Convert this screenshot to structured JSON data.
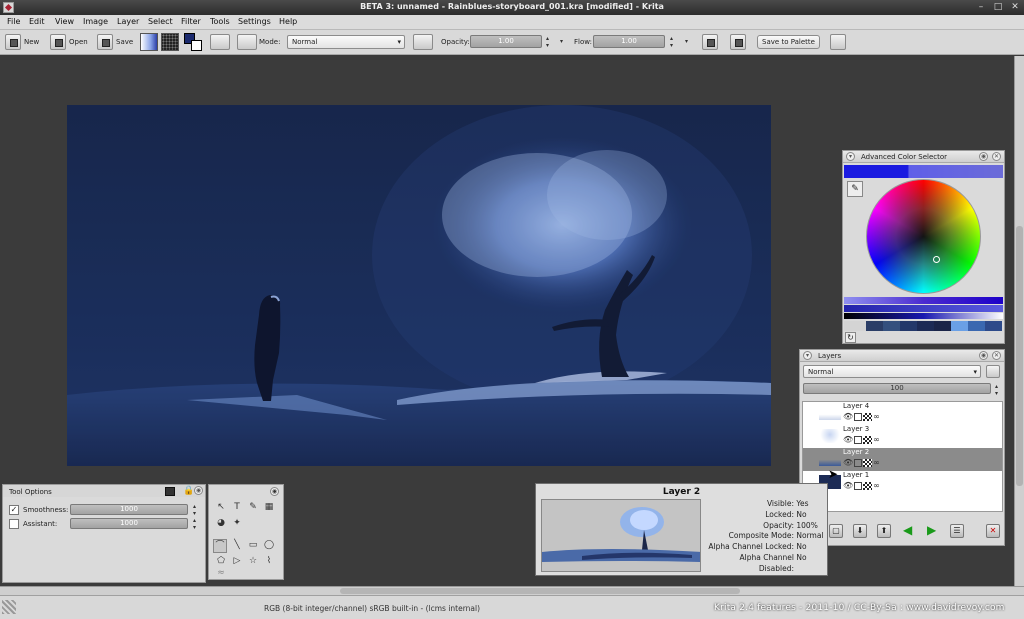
{
  "window": {
    "title": "BETA 3: unnamed - Rainblues-storyboard_001.kra [modified] - Krita",
    "controls": [
      "–",
      "□",
      "✕"
    ]
  },
  "menu": [
    "File",
    "Edit",
    "View",
    "Image",
    "Layer",
    "Select",
    "Filter",
    "Tools",
    "Settings",
    "Help"
  ],
  "toolbar": {
    "new_label": "New",
    "open_label": "Open",
    "save_label": "Save",
    "mode_label": "Mode:",
    "mode_value": "Normal",
    "opacity_label": "Opacity:",
    "opacity_value": "1.00",
    "flow_label": "Flow:",
    "flow_value": "1.00",
    "save_palette_label": "Save to Palette",
    "foreground_color": "#1b2a6e",
    "background_color": "#ffffff"
  },
  "tool_options": {
    "title": "Tool Options",
    "smoothness_label": "Smoothness:",
    "smoothness_value": "1000",
    "smoothness_checked": true,
    "assistant_label": "Assistant:",
    "assistant_value": "1000",
    "assistant_checked": false
  },
  "color_selector": {
    "title": "Advanced Color Selector",
    "current_color": "#1f1fd6",
    "history_colors": [
      "#2a3d66",
      "#34507e",
      "#23386a",
      "#1c2a55",
      "#1a2448",
      "#6aa0e6",
      "#3a68b0",
      "#2d4a8a"
    ]
  },
  "layers": {
    "title": "Layers",
    "blend_mode": "Normal",
    "opacity": "100",
    "items": [
      {
        "name": "Layer 4",
        "selected": false
      },
      {
        "name": "Layer 3",
        "selected": false
      },
      {
        "name": "Layer 2",
        "selected": true
      },
      {
        "name": "Layer 1",
        "selected": false
      }
    ]
  },
  "layer_tooltip": {
    "name": "Layer 2",
    "rows": [
      {
        "key": "Visible:",
        "value": "Yes"
      },
      {
        "key": "Locked:",
        "value": "No"
      },
      {
        "key": "Opacity:",
        "value": "100%"
      },
      {
        "key": "Composite Mode:",
        "value": "Normal"
      },
      {
        "key": "Alpha Channel Locked:",
        "value": "No"
      },
      {
        "key": "Alpha Channel",
        "value": "No"
      },
      {
        "key": "Disabled:",
        "value": ""
      }
    ]
  },
  "status": {
    "color_info": "RGB (8-bit integer/channel)  sRGB built-in - (lcms internal)",
    "credit": "Krita 2.4 features - 2011-10 / CC-By-Sa : www.davidrevoy.com"
  }
}
